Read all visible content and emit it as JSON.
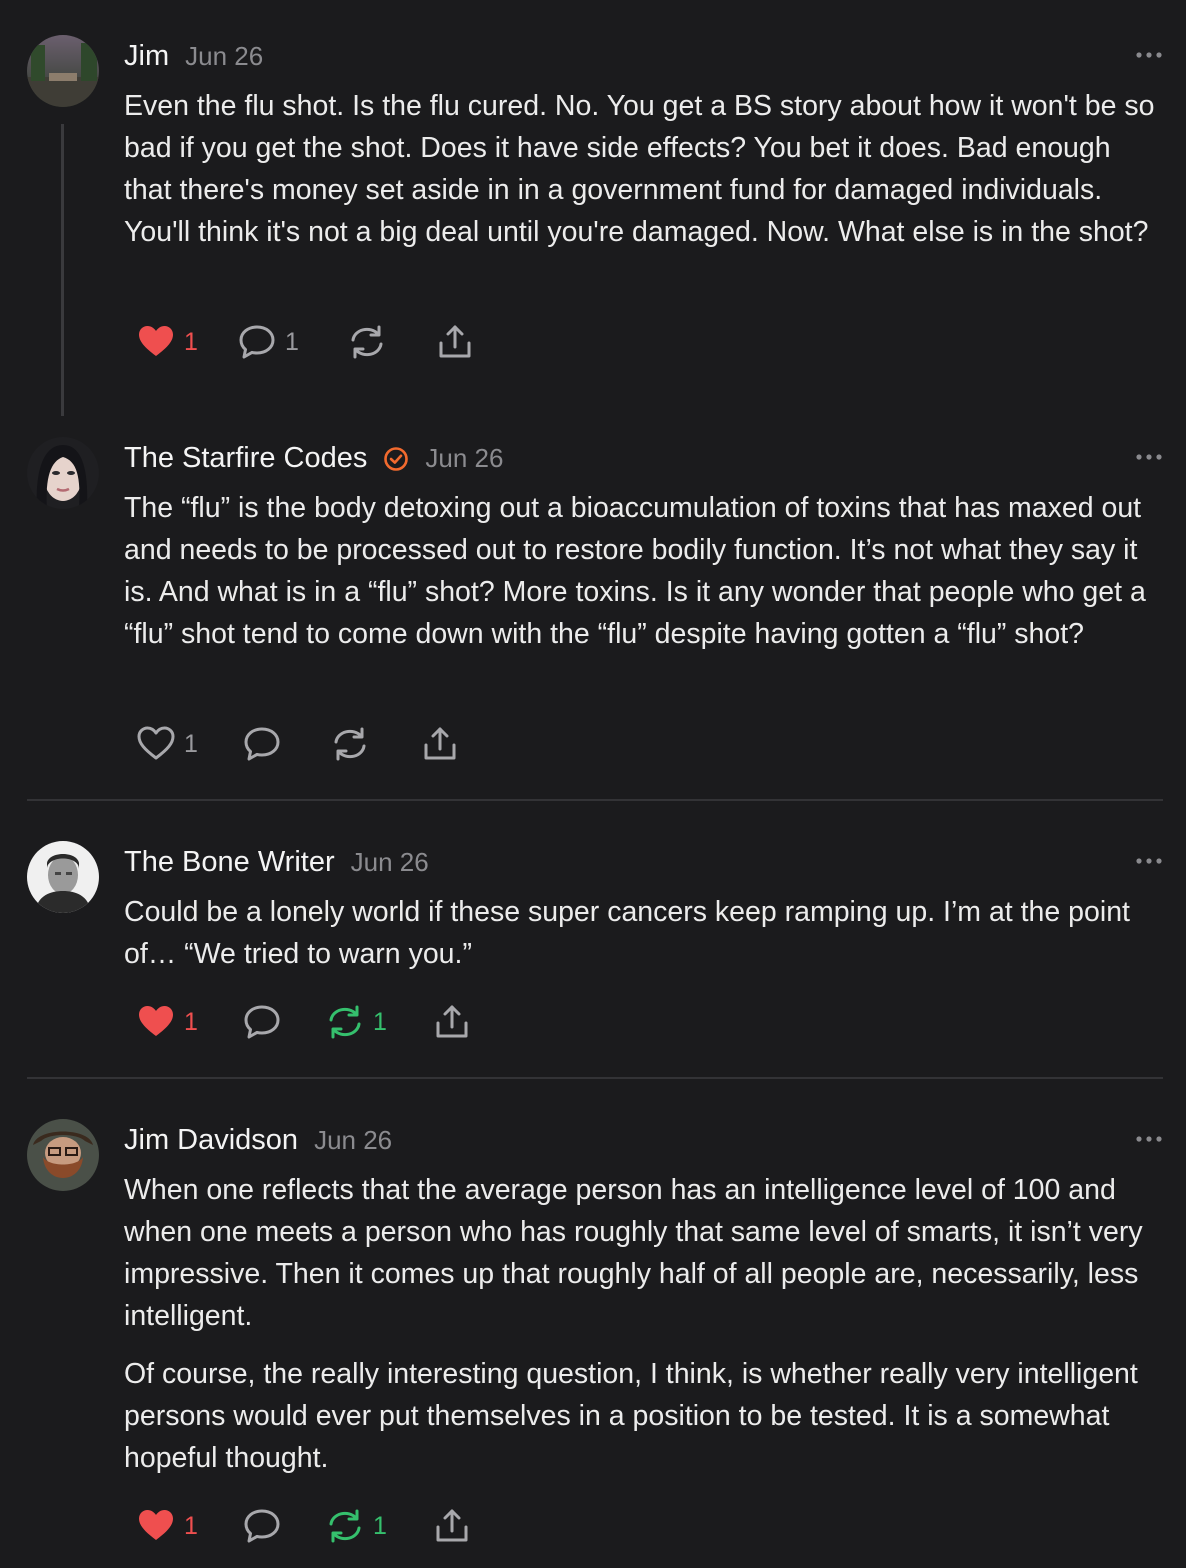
{
  "comments": [
    {
      "author": "Jim",
      "date": "Jun 26",
      "paragraphs": [
        "Even the flu shot. Is the flu cured. No. You get a BS story about how it won't be so bad if you get the shot. Does it have side effects? You bet it does. Bad enough that there's money set aside in in a government fund for damaged individuals. You'll think it's not a big deal until you're damaged. Now. What else is in the shot?"
      ],
      "likes": "1",
      "replies": "1",
      "restacks": "",
      "liked": true,
      "restacked": false
    },
    {
      "author": "The Starfire Codes",
      "date": "Jun 26",
      "verified": true,
      "paragraphs": [
        "The “flu” is the body detoxing out a bioaccumulation of toxins that has maxed out and needs to be processed out to restore bodily function. It’s not what they say it is. And what is in a “flu” shot? More toxins. Is it any wonder that people who get a “flu” shot tend to come down with the “flu” despite having gotten a “flu” shot?"
      ],
      "likes": "1",
      "replies": "",
      "restacks": "",
      "liked": false,
      "restacked": false
    },
    {
      "author": "The Bone Writer",
      "date": "Jun 26",
      "paragraphs": [
        "Could be a lonely world if these super cancers keep ramping up. I’m at the point of… “We tried to warn you.”"
      ],
      "likes": "1",
      "replies": "",
      "restacks": "1",
      "liked": true,
      "restacked": true
    },
    {
      "author": "Jim Davidson",
      "date": "Jun 26",
      "paragraphs": [
        "When one reflects that the average person has an intelligence level of 100 and when one meets a person who has roughly that same level of smarts, it isn’t very impressive. Then it comes up that roughly half of all people are, necessarily, less intelligent.",
        "Of course, the really interesting question, I think, is whether really very intelligent persons would ever put themselves in a position to be tested. It is a somewhat hopeful thought."
      ],
      "likes": "1",
      "replies": "",
      "restacks": "1",
      "liked": true,
      "restacked": true
    }
  ],
  "icons": {
    "like": "heart-icon",
    "reply": "comment-bubble-icon",
    "restack": "restack-icon",
    "share": "share-icon",
    "more": "more-options-icon",
    "verified": "verified-check-icon"
  },
  "colors": {
    "background": "#1b1b1d",
    "like_active": "#ef4f4f",
    "restack_active": "#35c06d",
    "verified": "#f26a2e"
  }
}
